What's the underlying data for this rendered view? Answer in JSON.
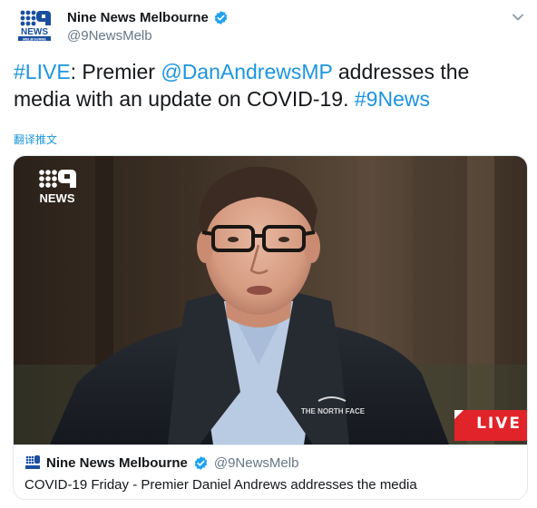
{
  "author": {
    "name": "Nine News Melbourne",
    "handle": "@9NewsMelb",
    "avatar_text": "NEWS",
    "avatar_subtext": "MELBOURNE"
  },
  "tweet": {
    "part1": "#LIVE",
    "part2": ": Premier ",
    "part3": "@DanAndrewsMP",
    "part4": " addresses the media with an update on COVID-19. ",
    "part5": "#9News"
  },
  "translate_label": "翻译推文",
  "video": {
    "logo_text": "NEWS",
    "live_label": "LIVE",
    "jacket_text": "THE NORTH FACE"
  },
  "card": {
    "name": "Nine News Melbourne",
    "handle": "@9NewsMelb",
    "title": "COVID-19 Friday - Premier Daniel Andrews addresses the media"
  },
  "colors": {
    "link": "#1b95e0",
    "verified": "#1da1f2",
    "live_red": "#e0242a",
    "brand_blue": "#1a4fa0"
  },
  "icons": {
    "verified": "verified-icon",
    "caret": "chevron-down-icon"
  }
}
